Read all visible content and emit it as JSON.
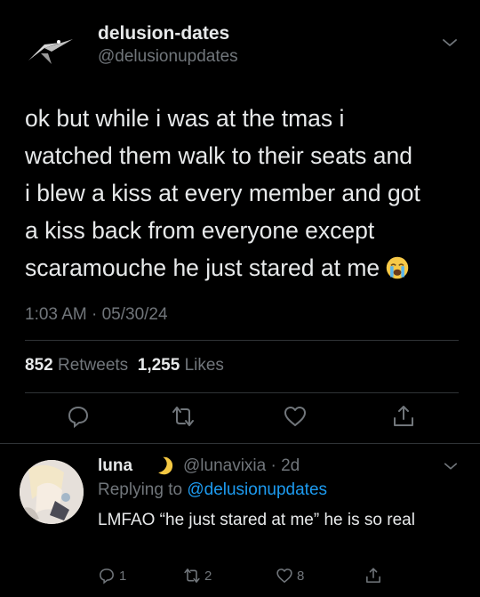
{
  "tweet": {
    "display_name": "delusion-dates",
    "handle": "@delusionupdates",
    "text": "ok but while i was at the tmas i\nwatched them walk to their seats and\ni blew a kiss at every member and got\na kiss back from everyone except\nscaramouche he just stared at me",
    "emoji": "loudly-crying-face",
    "timestamp": "1:03 AM · 05/30/24",
    "retweets_count": "852",
    "retweets_label": "Retweets",
    "likes_count": "1,255",
    "likes_label": "Likes"
  },
  "reply": {
    "display_name": "luna",
    "handle_time": "@lunavixia · 2d",
    "replying_prefix": "Replying to",
    "replying_handle": "@delusionupdates",
    "text": "LMFAO “he just stared at me” he is so real",
    "reply_count": "1",
    "retweet_count": "2",
    "like_count": "8"
  },
  "colors": {
    "background": "#000000",
    "primary_text": "#e7e9ea",
    "secondary_text": "#71767b",
    "link": "#1d9bf0",
    "divider": "#2f3336"
  },
  "icons": [
    "logo-icon",
    "chevron-down-icon",
    "reply-icon",
    "retweet-icon",
    "like-icon",
    "share-icon",
    "moon-icon"
  ]
}
